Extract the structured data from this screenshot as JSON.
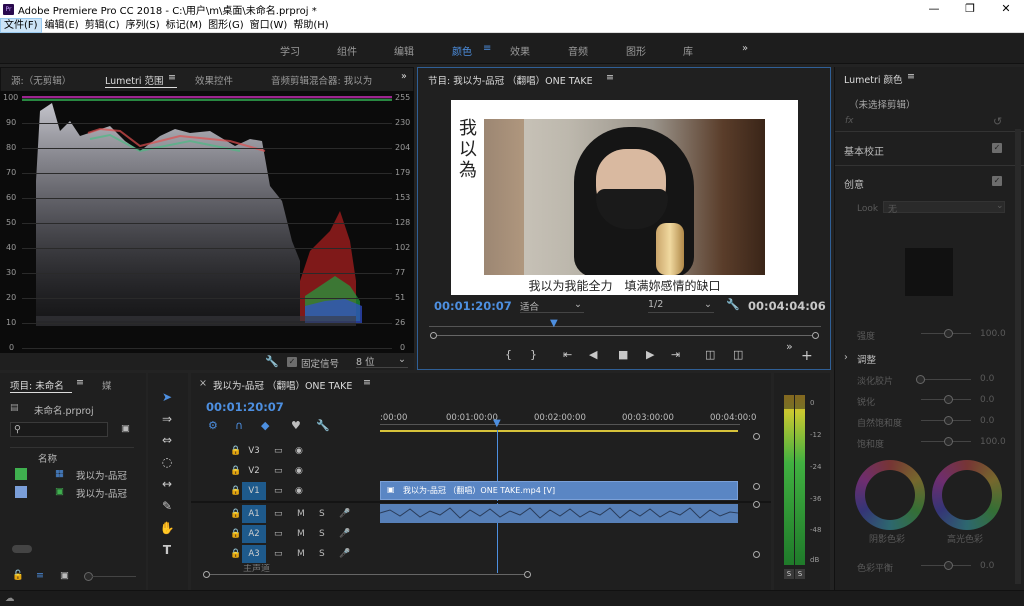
{
  "window": {
    "title": "Adobe Premiere Pro CC 2018 - C:\\用户\\m\\桌面\\未命名.prproj *",
    "app_icon": "Pr"
  },
  "menu": [
    "文件(F)",
    "编辑(E)",
    "剪辑(C)",
    "序列(S)",
    "标记(M)",
    "图形(G)",
    "窗口(W)",
    "帮助(H)"
  ],
  "workspaces": [
    "学习",
    "组件",
    "编辑",
    "颜色",
    "效果",
    "音频",
    "图形",
    "库"
  ],
  "workspace_active": "颜色",
  "source_panel": {
    "tabs": [
      "源:（无剪辑）",
      "Lumetri 范围",
      "效果控件",
      "音频剪辑混合器: 我以为"
    ],
    "scale_left": [
      "100",
      "90",
      "80",
      "70",
      "60",
      "50",
      "40",
      "30",
      "20",
      "10",
      "0"
    ],
    "scale_right": [
      "255",
      "230",
      "204",
      "179",
      "153",
      "128",
      "102",
      "77",
      "51",
      "26",
      "0"
    ],
    "clamp_label": "固定信号",
    "bits_value": "8 位"
  },
  "program": {
    "tab": "节目: 我以为-品冠 （翻唱）ONE TAKE",
    "video_title": "我以為",
    "subtitle": "我以为我能全力　填满妳感情的缺口",
    "timecode": "00:01:20:07",
    "fit": "适合",
    "resolution": "1/2",
    "duration": "00:04:04:06"
  },
  "lumetri": {
    "title": "Lumetri 颜色",
    "no_clip": "（未选择剪辑）",
    "fx": "fx",
    "basic": "基本校正",
    "creative": "创意",
    "look_label": "Look",
    "look_value": "无",
    "intensity_label": "强度",
    "intensity_value": "100.0",
    "adjust": "调整",
    "sliders": [
      {
        "label": "淡化胶片",
        "value": "0.0"
      },
      {
        "label": "锐化",
        "value": "0.0"
      },
      {
        "label": "自然饱和度",
        "value": "0.0"
      },
      {
        "label": "饱和度",
        "value": "100.0"
      }
    ],
    "wheel_left": "阴影色彩",
    "wheel_right": "高光色彩",
    "balance_label": "色彩平衡",
    "balance_value": "0.0"
  },
  "project": {
    "tabs": [
      "项目: 未命名",
      "媒"
    ],
    "file": "未命名.prproj",
    "column": "名称",
    "items": [
      {
        "name": "我以为-品冠",
        "color": "#3fb04f"
      },
      {
        "name": "我以为-品冠",
        "color": "#7a9ed8"
      }
    ]
  },
  "timeline": {
    "tab": "我以为-品冠 （翻唱）ONE TAKE",
    "timecode": "00:01:20:07",
    "ruler": [
      ":00:00",
      "00:01:00:00",
      "00:02:00:00",
      "00:03:00:00",
      "00:04:00:0"
    ],
    "video_tracks": [
      "V3",
      "V2",
      "V1"
    ],
    "audio_tracks": [
      "A1",
      "A2",
      "A3"
    ],
    "clip_video": "我以为-品冠 （翻唱）ONE TAKE.mp4 [V]",
    "master": "主声道"
  },
  "meter": {
    "scale": [
      "0",
      "-12",
      "-24",
      "-36",
      "-48",
      "dB"
    ],
    "solo": [
      "S",
      "S"
    ]
  },
  "colors": {
    "accent": "#4d8fe0",
    "clip_video": "#5a86c4",
    "clip_audio": "#5780b8",
    "track_target": "#1e5a8c",
    "playhead": "#4d8fe0"
  }
}
